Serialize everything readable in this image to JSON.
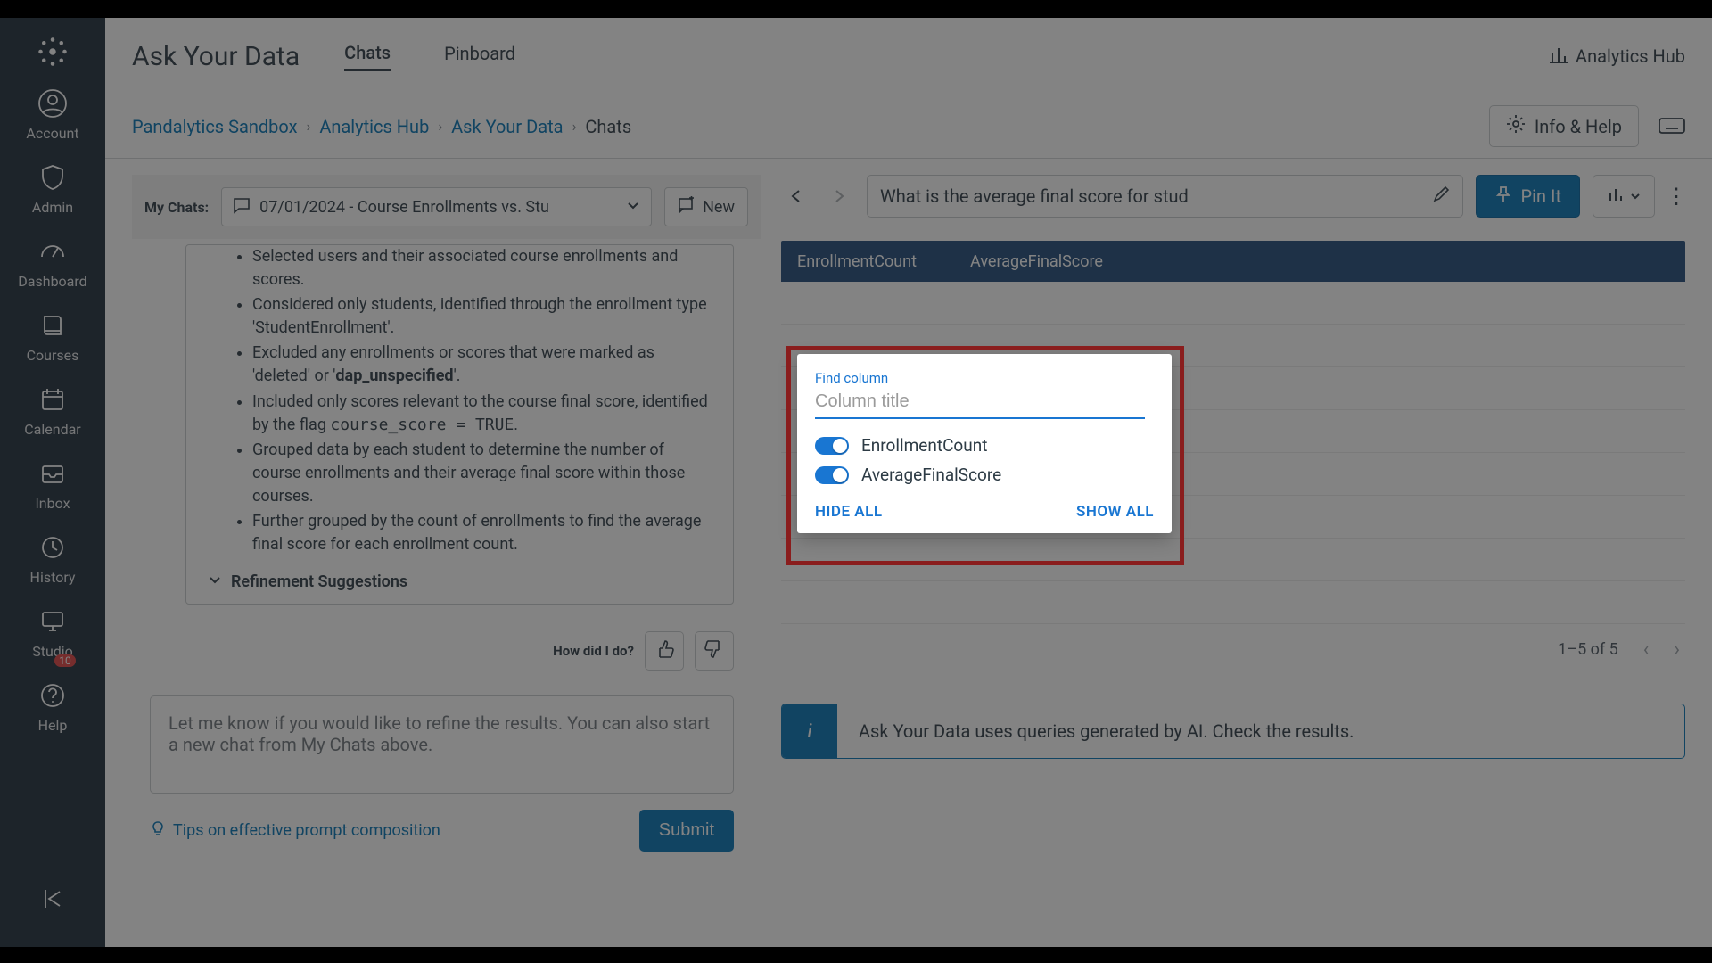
{
  "leftnav": {
    "items": [
      {
        "label": "Account"
      },
      {
        "label": "Admin"
      },
      {
        "label": "Dashboard"
      },
      {
        "label": "Courses"
      },
      {
        "label": "Calendar"
      },
      {
        "label": "Inbox"
      },
      {
        "label": "History"
      },
      {
        "label": "Studio"
      },
      {
        "label": "Help",
        "badge": "10"
      }
    ]
  },
  "topbar": {
    "title": "Ask Your Data",
    "tabs": [
      {
        "label": "Chats",
        "active": true
      },
      {
        "label": "Pinboard"
      }
    ],
    "analytics_link": "Analytics Hub"
  },
  "breadcrumb": {
    "items": [
      "Pandalytics Sandbox",
      "Analytics Hub",
      "Ask Your Data",
      "Chats"
    ],
    "info_help": "Info & Help"
  },
  "mychats": {
    "label": "My Chats:",
    "selected": "07/01/2024 - Course Enrollments vs. Stu",
    "new_label": "New"
  },
  "log": {
    "bullets": [
      {
        "text": "Selected users and their associated course enrollments and scores."
      },
      {
        "text": "Considered only students, identified through the enrollment type 'StudentEnrollment'."
      },
      {
        "text": "Excluded any enrollments or scores that were marked as 'deleted' or '",
        "bold": "dap_unspecified",
        "tail": "'."
      },
      {
        "text": "Included only scores relevant to the course final score, identified by the flag ",
        "code": "course_score = TRUE",
        "tail": "."
      },
      {
        "text": "Grouped data by each student to determine the number of course enrollments and their average final score within those courses."
      },
      {
        "text": "Further grouped by the count of enrollments to find the average final score for each enrollment count."
      }
    ],
    "refine": "Refinement Suggestions",
    "feedback_q": "How did I do?"
  },
  "composer": {
    "placeholder": "Let me know if you would like to refine the results.  You can also start a new chat from My Chats above."
  },
  "tips": "Tips on effective prompt composition",
  "submit": "Submit",
  "rightpanel": {
    "query": "What is the average final score for stud",
    "pin": "Pin It",
    "columns": [
      "EnrollmentCount",
      "AverageFinalScore"
    ],
    "pager": "1–5 of 5",
    "notice": "Ask Your Data uses queries generated by AI. Check the results."
  },
  "popup": {
    "label": "Find column",
    "placeholder": "Column title",
    "toggles": [
      {
        "name": "EnrollmentCount",
        "on": true
      },
      {
        "name": "AverageFinalScore",
        "on": true
      }
    ],
    "hide": "HIDE ALL",
    "show": "SHOW ALL"
  }
}
